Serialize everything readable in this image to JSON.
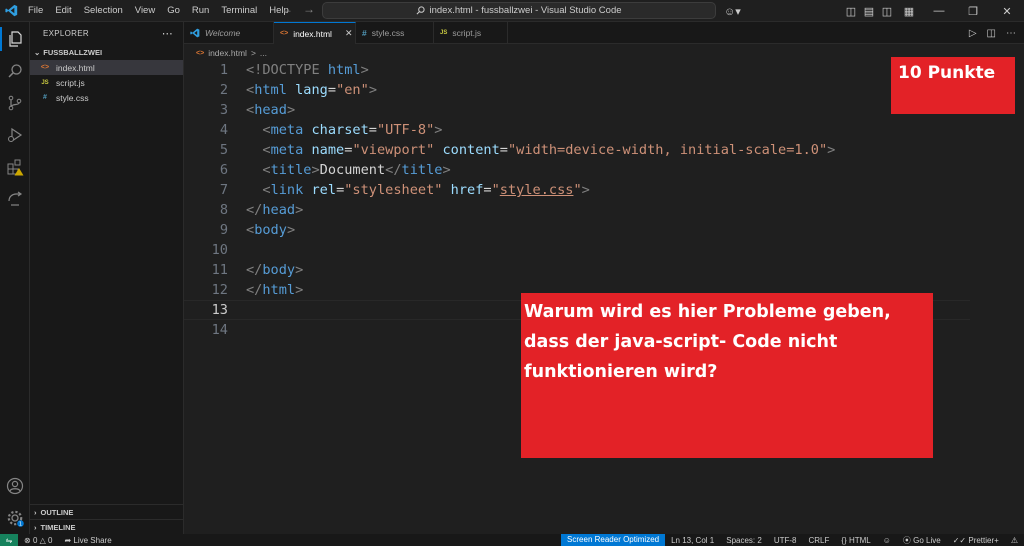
{
  "titlebar": {
    "menu": [
      "File",
      "Edit",
      "Selection",
      "View",
      "Go",
      "Run",
      "Terminal",
      "Help"
    ],
    "command_center": "index.html - fussballzwei - Visual Studio Code"
  },
  "sidebar": {
    "title": "EXPLORER",
    "folder": "FUSSBALLZWEI",
    "files": [
      {
        "icon": "<>",
        "name": "index.html"
      },
      {
        "icon": "JS",
        "name": "script.js"
      },
      {
        "icon": "#",
        "name": "style.css"
      }
    ],
    "outline": "OUTLINE",
    "timeline": "TIMELINE"
  },
  "tabs": [
    {
      "icon": "vscode-icon",
      "label": "Welcome"
    },
    {
      "icon": "<>",
      "label": "index.html"
    },
    {
      "icon": "#",
      "label": "style.css"
    },
    {
      "icon": "JS",
      "label": "script.js"
    }
  ],
  "breadcrumb": {
    "file": "index.html",
    "sep": ">",
    "rest": "..."
  },
  "editor": {
    "line_numbers": [
      "1",
      "2",
      "3",
      "4",
      "5",
      "6",
      "7",
      "8",
      "9",
      "10",
      "11",
      "12",
      "13",
      "14"
    ],
    "current_line": 13
  },
  "overlays": {
    "points": "10 Punkte",
    "question": "Warum wird es hier Probleme geben, dass der java-script- Code nicht funktionieren wird?"
  },
  "statusbar": {
    "errors": "0",
    "warnings": "0",
    "live_share": "Live Share",
    "screen_reader": "Screen Reader Optimized",
    "position": "Ln 13, Col 1",
    "spaces": "Spaces: 2",
    "encoding": "UTF-8",
    "eol": "CRLF",
    "language": "HTML",
    "go_live": "Go Live",
    "prettier": "Prettier+",
    "notifications": "1"
  },
  "colors": {
    "accent": "#0078d4",
    "overlay": "#e32227",
    "remote": "#16825d"
  }
}
